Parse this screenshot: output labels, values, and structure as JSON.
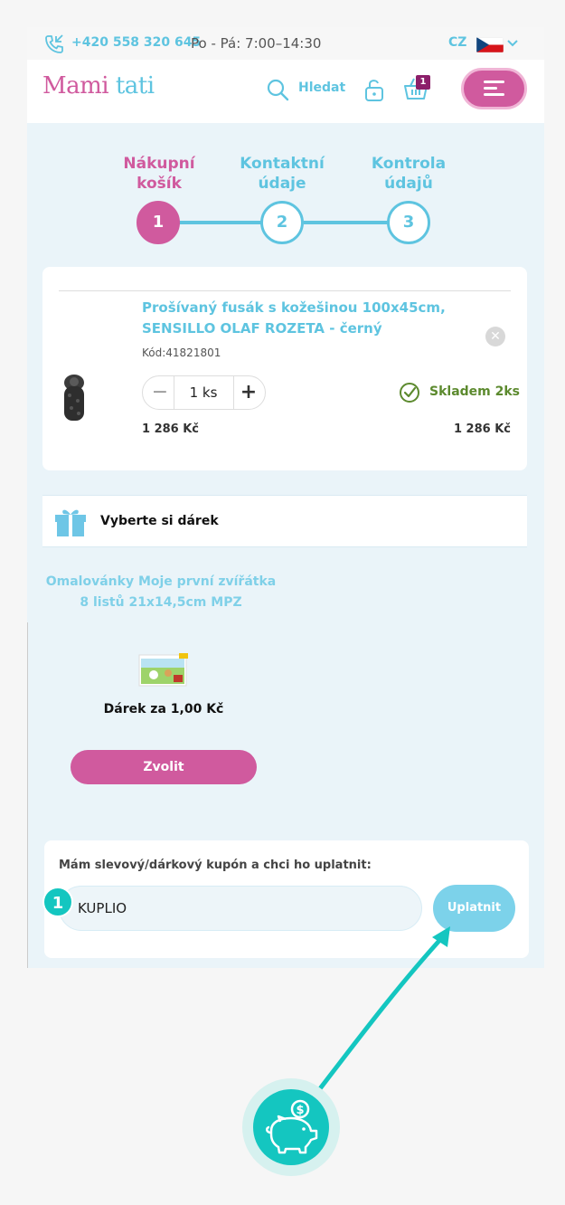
{
  "topbar": {
    "phone": "+420 558 320 645",
    "hours": "Po - Pá: 7:00–14:30",
    "lang": "CZ"
  },
  "header": {
    "logo_mami": "Mami",
    "logo_tati": "tati",
    "search_label": "Hledat",
    "cart_count": "1"
  },
  "steps": [
    {
      "label_line1": "Nákupní",
      "label_line2": "košík",
      "number": "1"
    },
    {
      "label_line1": "Kontaktní",
      "label_line2": "údaje",
      "number": "2"
    },
    {
      "label_line1": "Kontrola",
      "label_line2": "údajů",
      "number": "3"
    }
  ],
  "cart_item": {
    "name_line1": "Prošívaný fusák s kožešinou 100x45cm,",
    "name_line2": "SENSILLO OLAF ROZETA - černý",
    "code": "Kód:41821801",
    "quantity": "1 ks",
    "stock": "Skladem 2ks",
    "unit_price": "1 286 Kč",
    "total_price": "1 286 Kč"
  },
  "gift": {
    "section_title": "Vyberte si dárek",
    "item_line1": "Omalovánky Moje první zvířátka",
    "item_line2": "8 listů 21x14,5cm MPZ",
    "price_label": "Dárek za 1,00 Kč",
    "choose_label": "Zvolit"
  },
  "coupon": {
    "label": "Mám slevový/dárkový kupón a chci ho uplatnit:",
    "value": "KUPLIO",
    "apply_label": "Uplatnit"
  },
  "annotation": {
    "marker": "1",
    "coin_symbol": "$"
  },
  "colors": {
    "pink": "#d05a9e",
    "blue": "#5ec4e0",
    "teal": "#14c6c0",
    "green": "#5c8a2e"
  }
}
